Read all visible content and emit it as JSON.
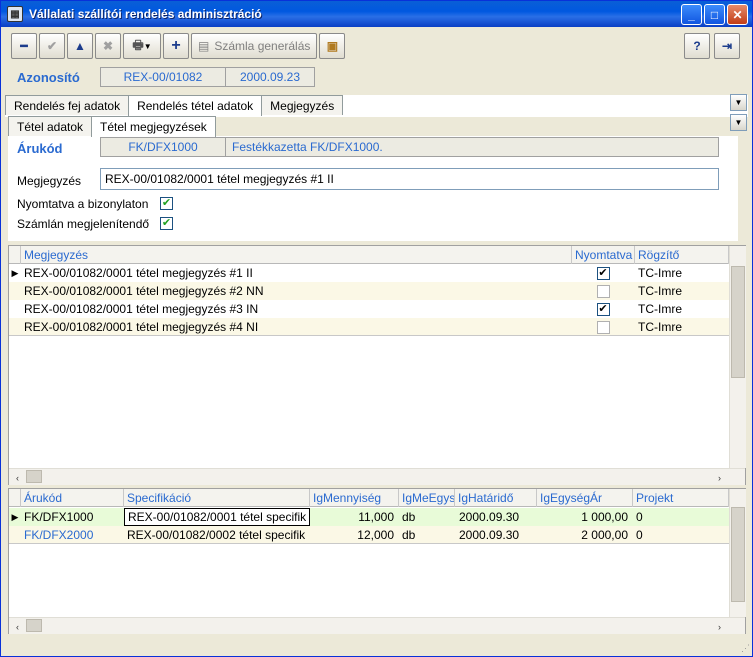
{
  "window": {
    "title": "Vállalati szállítói rendelés adminisztráció"
  },
  "toolbar": {
    "invoice_label": "Számla generálás"
  },
  "id_row": {
    "label": "Azonosító",
    "id_value": "REX-00/01082",
    "date_value": "2000.09.23"
  },
  "tabs_main": [
    "Rendelés fej adatok",
    "Rendelés tétel adatok",
    "Megjegyzés"
  ],
  "tabs_sub": [
    "Tétel adatok",
    "Tétel megjegyzések"
  ],
  "form": {
    "aru_label": "Árukód",
    "aru_code": "FK/DFX1000",
    "aru_name": "Festékkazetta FK/DFX1000.",
    "megj_label": "Megjegyzés",
    "megj_value": "REX-00/01082/0001 tétel megjegyzés #1 II",
    "printed_label": "Nyomtatva a bizonylaton",
    "invoice_label": "Számlán megjelenítendő"
  },
  "notes_grid": {
    "headers": [
      "Megjegyzés",
      "Nyomtatva",
      "Rögzítő"
    ],
    "rows": [
      {
        "text": "REX-00/01082/0001 tétel megjegyzés #1 II",
        "printed": "✔",
        "by": "TC-Imre"
      },
      {
        "text": "REX-00/01082/0001 tétel megjegyzés #2 NN",
        "printed": "",
        "by": "TC-Imre"
      },
      {
        "text": "REX-00/01082/0001 tétel megjegyzés #3 IN",
        "printed": "✔",
        "by": "TC-Imre"
      },
      {
        "text": "REX-00/01082/0001 tétel megjegyzés #4 NI",
        "printed": "",
        "by": "TC-Imre"
      }
    ]
  },
  "items_grid": {
    "headers": [
      "Árukód",
      "Specifikáció",
      "IgMennyiség",
      "IgMeEgys",
      "IgHatáridő",
      "IgEgységÁr",
      "Projekt"
    ],
    "rows": [
      {
        "code": "FK/DFX1000",
        "spec": "REX-00/01082/0001 tétel specifik",
        "qty": "11,000",
        "unit": "db",
        "due": "2000.09.30",
        "price": "1 000,00",
        "project": "0"
      },
      {
        "code": "FK/DFX2000",
        "spec": "REX-00/01082/0002 tétel specifik",
        "qty": "12,000",
        "unit": "db",
        "due": "2000.09.30",
        "price": "2 000,00",
        "project": "0"
      }
    ]
  }
}
